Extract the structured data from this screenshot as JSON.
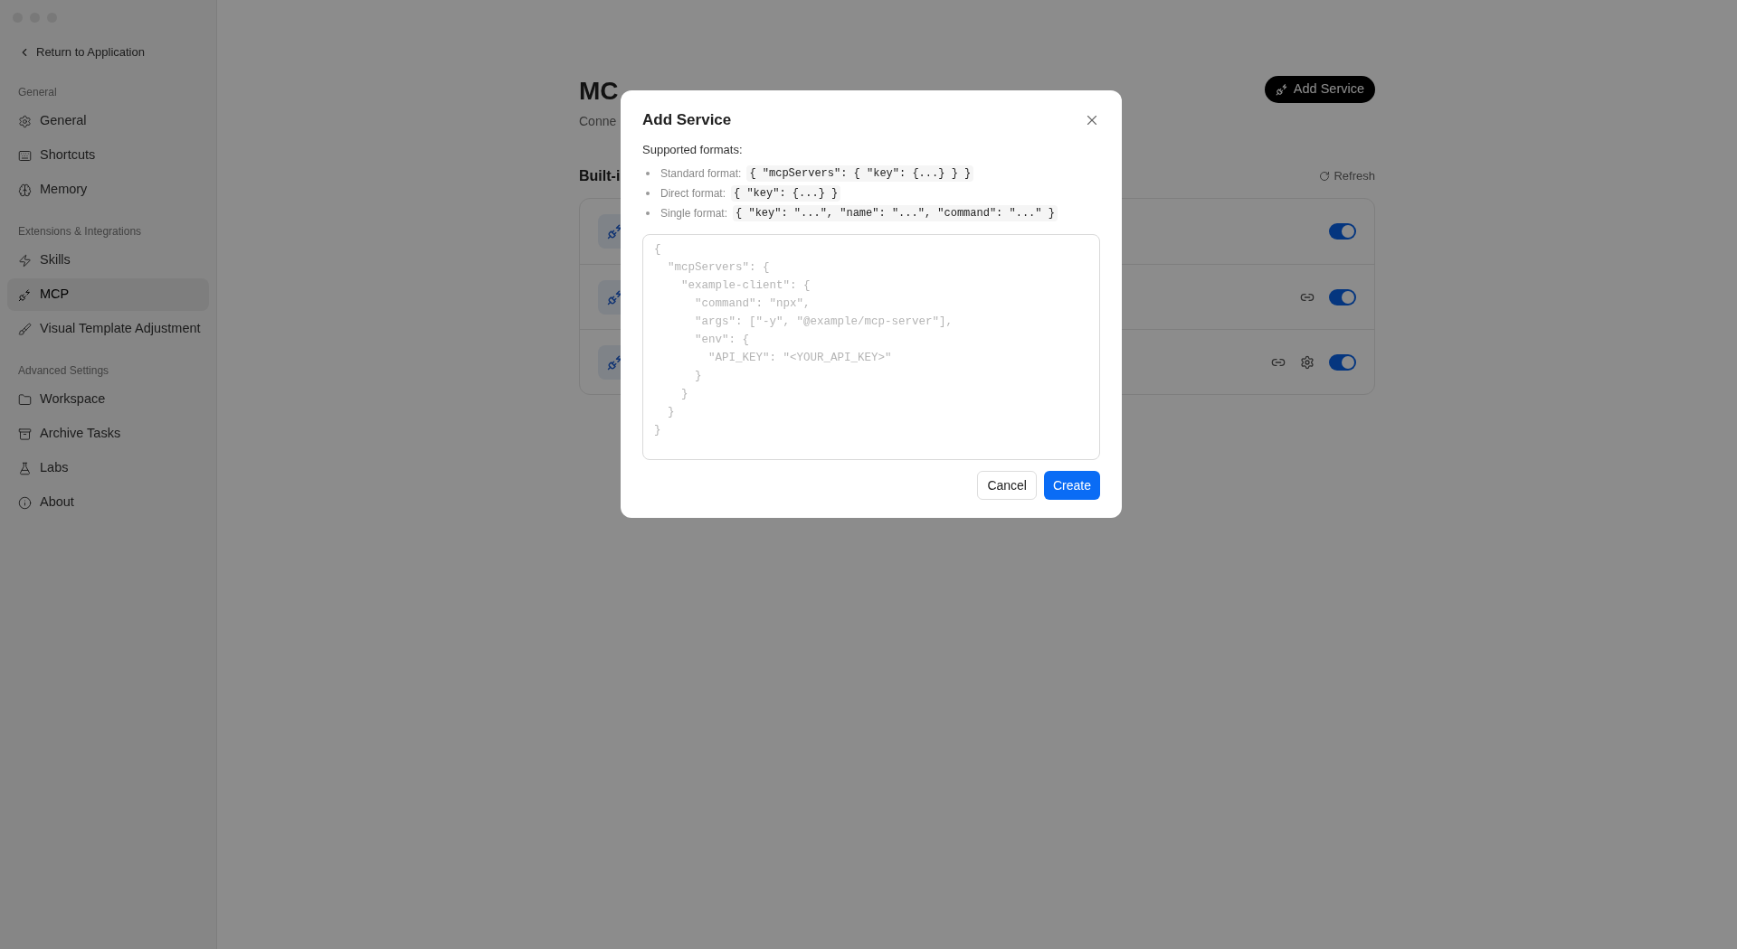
{
  "sidebar": {
    "back_link": "Return to Application",
    "sections": [
      {
        "title": "General",
        "items": [
          {
            "label": "General",
            "selected": false
          },
          {
            "label": "Shortcuts",
            "selected": false
          },
          {
            "label": "Memory",
            "selected": false
          }
        ]
      },
      {
        "title": "Extensions & Integrations",
        "items": [
          {
            "label": "Skills",
            "selected": false
          },
          {
            "label": "MCP",
            "selected": true
          },
          {
            "label": "Visual Template Adjustment",
            "selected": false
          }
        ]
      },
      {
        "title": "Advanced Settings",
        "items": [
          {
            "label": "Workspace",
            "selected": false
          },
          {
            "label": "Archive Tasks",
            "selected": false
          },
          {
            "label": "Labs",
            "selected": false
          },
          {
            "label": "About",
            "selected": false
          }
        ]
      }
    ]
  },
  "page": {
    "title": "MC",
    "subtitle": "Conne",
    "add_button": "Add Service",
    "section_title": "Built-i",
    "refresh": "Refresh",
    "services": [
      {
        "link": false,
        "settings": false,
        "on": true
      },
      {
        "link": true,
        "settings": false,
        "on": true
      },
      {
        "link": true,
        "settings": true,
        "on": true
      }
    ]
  },
  "dialog": {
    "title": "Add Service",
    "intro": "Supported formats:",
    "formats": [
      {
        "label": "Standard format:",
        "code": "{ \"mcpServers\": { \"key\": {...} } }"
      },
      {
        "label": "Direct format:",
        "code": "{ \"key\": {...} }"
      },
      {
        "label": "Single format:",
        "code": "{ \"key\": \"...\", \"name\": \"...\", \"command\": \"...\" }"
      }
    ],
    "placeholder": "{\n  \"mcpServers\": {\n    \"example-client\": {\n      \"command\": \"npx\",\n      \"args\": [\"-y\", \"@example/mcp-server\"],\n      \"env\": {\n        \"API_KEY\": \"<YOUR_API_KEY>\"\n      }\n    }\n  }\n}",
    "buttons": [
      {
        "label": "Cancel",
        "kind": "secondary"
      },
      {
        "label": "Create",
        "kind": "primary"
      }
    ]
  }
}
